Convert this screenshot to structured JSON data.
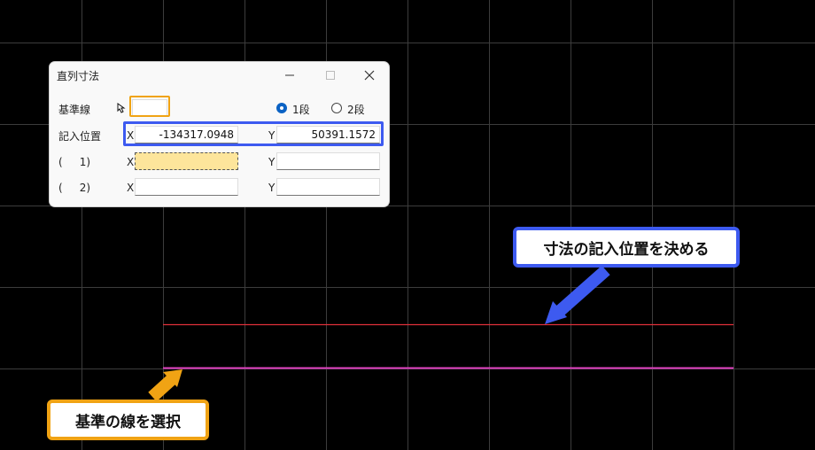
{
  "dialog": {
    "title": "直列寸法",
    "rows": {
      "base_line": {
        "label": "基準線"
      },
      "entry_position": {
        "label": "記入位置",
        "x_label": "X",
        "x_value": "-134317.0948",
        "y_label": "Y",
        "y_value": "50391.1572"
      },
      "row1": {
        "label": "(     1)",
        "x_label": "X",
        "x_value": "",
        "y_label": "Y",
        "y_value": ""
      },
      "row2": {
        "label": "(     2)",
        "x_label": "X",
        "x_value": "",
        "y_label": "Y",
        "y_value": ""
      }
    },
    "radio": [
      {
        "label": "1段",
        "selected": true
      },
      {
        "label": "2段",
        "selected": false
      }
    ]
  },
  "callouts": {
    "entry_position": "寸法の記入位置を決める",
    "select_base": "基準の線を選択"
  },
  "colors": {
    "background": "#000000",
    "grid": "#3c3c3c",
    "red_line": "#e0303a",
    "magenta_line": "#e040c0",
    "blue_accent": "#3d5af0",
    "orange_accent": "#f0a314",
    "active_field": "#fde59b",
    "radio_selected": "#0b62c4"
  }
}
